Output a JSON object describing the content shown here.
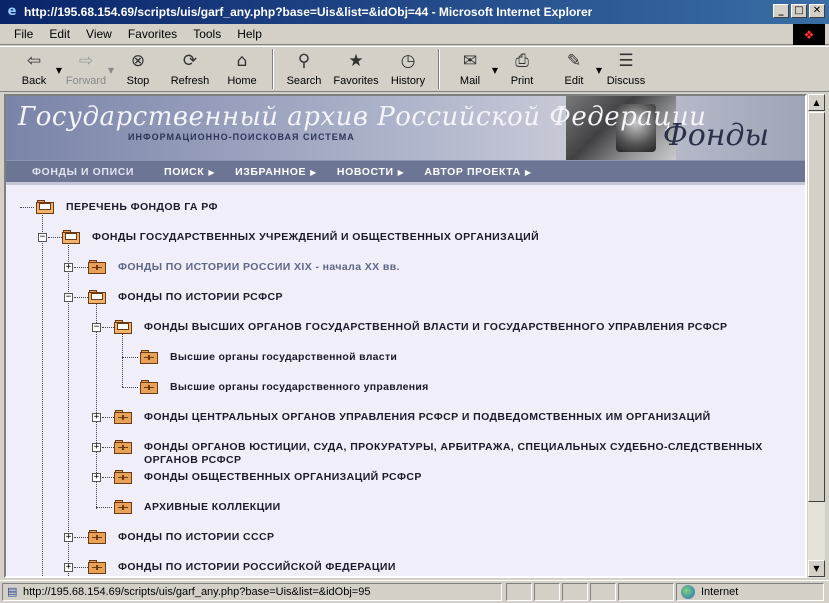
{
  "window": {
    "title": "http://195.68.154.69/scripts/uis/garf_any.php?base=Uis&list=&idObj=44 - Microsoft Internet Explorer",
    "minimize": "_",
    "maximize": "□",
    "close": "✕"
  },
  "menu": [
    "File",
    "Edit",
    "View",
    "Favorites",
    "Tools",
    "Help"
  ],
  "toolbar": {
    "back": "Back",
    "forward": "Forward",
    "stop": "Stop",
    "refresh": "Refresh",
    "home": "Home",
    "search": "Search",
    "favorites": "Favorites",
    "history": "History",
    "mail": "Mail",
    "print": "Print",
    "edit": "Edit",
    "discuss": "Discuss"
  },
  "banner": {
    "title": "Государственный архив Российской Федерации",
    "subtitle": "ИНФОРМАЦИОННО-ПОИСКОВАЯ СИСТЕМА",
    "section": "Фонды"
  },
  "nav": {
    "items": [
      "ФОНДЫ И ОПИСИ",
      "ПОИСК",
      "ИЗБРАННОЕ",
      "НОВОСТИ",
      "АВТОР ПРОЕКТА"
    ],
    "active_index": 0
  },
  "tree": {
    "root": "ПЕРЕЧЕНЬ ФОНДОВ ГА РФ",
    "state_orgs": "ФОНДЫ ГОСУДАРСТВЕННЫХ УЧРЕЖДЕНИЙ И ОБЩЕСТВЕННЫХ ОРГАНИЗАЦИЙ",
    "russia_history": "ФОНДЫ ПО ИСТОРИИ РОССИИ XIX - начала XX вв.",
    "rsfsr_history": "ФОНДЫ ПО ИСТОРИИ РСФСР",
    "higher_organs": "ФОНДЫ ВЫСШИХ ОРГАНОВ ГОСУДАРСТВЕННОЙ ВЛАСТИ И ГОСУДАРСТВЕННОГО УПРАВЛЕНИЯ РСФСР",
    "higher_power": "Высшие органы государственной власти",
    "higher_admin": "Высшие органы государственного управления",
    "central_organs": "ФОНДЫ ЦЕНТРАЛЬНЫХ ОРГАНОВ УПРАВЛЕНИЯ РСФСР И ПОДВЕДОМСТВЕННЫХ ИМ ОРГАНИЗАЦИЙ",
    "justice": "ФОНДЫ ОРГАНОВ ЮСТИЦИИ, СУДА, ПРОКУРАТУРЫ, АРБИТРАЖА, СПЕЦИАЛЬНЫХ СУДЕБНО-СЛЕДСТВЕННЫХ ОРГАНОВ РСФСР",
    "public_orgs": "ФОНДЫ ОБЩЕСТВЕННЫХ ОРГАНИЗАЦИЙ РСФСР",
    "archive_collections": "АРХИВНЫЕ КОЛЛЕКЦИИ",
    "ussr_history": "ФОНДЫ ПО ИСТОРИИ СССР",
    "rf_history": "ФОНДЫ ПО ИСТОРИИ РОССИЙСКОЙ ФЕДЕРАЦИИ"
  },
  "status": {
    "url": "http://195.68.154.69/scripts/uis/garf_any.php?base=Uis&list=&idObj=95",
    "zone": "Internet"
  }
}
